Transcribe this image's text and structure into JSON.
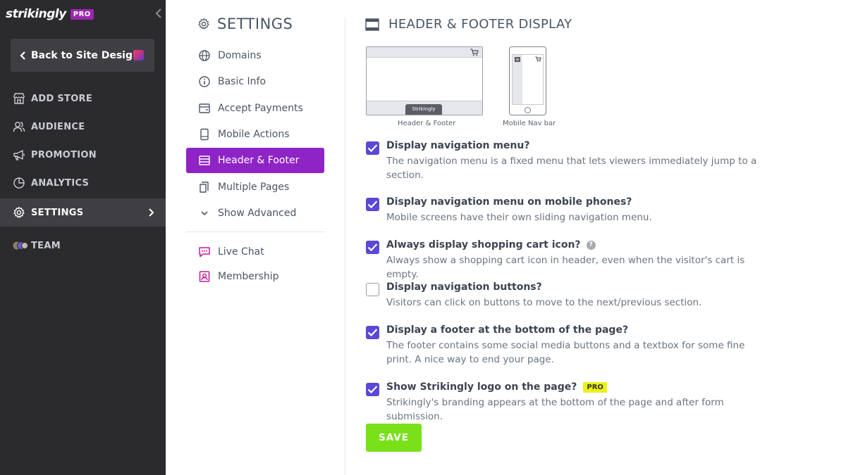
{
  "brand": {
    "logo_text": "strikingly",
    "plan_badge": "PRO"
  },
  "sidebar": {
    "back_label": "Back to Site Design",
    "items": [
      {
        "label": "ADD STORE",
        "icon": "store-icon"
      },
      {
        "label": "AUDIENCE",
        "icon": "users-icon"
      },
      {
        "label": "PROMOTION",
        "icon": "megaphone-icon"
      },
      {
        "label": "ANALYTICS",
        "icon": "pie-chart-icon"
      },
      {
        "label": "SETTINGS",
        "icon": "gear-icon",
        "active": true
      },
      {
        "label": "TEAM",
        "icon": "team-avatars-icon"
      }
    ]
  },
  "settings_nav": {
    "title": "SETTINGS",
    "items": [
      {
        "label": "Domains",
        "icon": "globe-icon"
      },
      {
        "label": "Basic Info",
        "icon": "info-icon"
      },
      {
        "label": "Accept Payments",
        "icon": "wallet-icon"
      },
      {
        "label": "Mobile Actions",
        "icon": "phone-icon"
      },
      {
        "label": "Header & Footer",
        "icon": "header-footer-icon",
        "active": true
      },
      {
        "label": "Multiple Pages",
        "icon": "pages-icon"
      },
      {
        "label": "Show Advanced",
        "icon": "chevron-down-icon"
      }
    ],
    "apps": [
      {
        "label": "Live Chat",
        "icon": "chat-icon"
      },
      {
        "label": "Membership",
        "icon": "membership-icon"
      }
    ]
  },
  "main": {
    "title": "HEADER & FOOTER DISPLAY",
    "previews": {
      "desktop_caption": "Header & Footer",
      "desktop_brand": "Strikingly",
      "mobile_caption": "Mobile Nav bar"
    },
    "options": [
      {
        "title": "Display navigation menu?",
        "desc": "The navigation menu is a fixed menu that lets viewers immediately jump to a section.",
        "checked": true
      },
      {
        "title": "Display navigation menu on mobile phones?",
        "desc": "Mobile screens have their own sliding navigation menu.",
        "checked": true
      },
      {
        "title": "Always display shopping cart icon?",
        "desc": "Always show a shopping cart icon in header, even when the visitor's cart is empty.",
        "checked": true,
        "help": "?"
      },
      {
        "title": "Display navigation buttons?",
        "desc": "Visitors can click on buttons to move to the next/previous section.",
        "checked": false
      },
      {
        "title": "Display a footer at the bottom of the page?",
        "desc": "The footer contains some social media buttons and a textbox for some fine print. A nice way to end your page.",
        "checked": true
      },
      {
        "title": "Show Strikingly logo on the page?",
        "desc": "Strikingly's branding appears at the bottom of the page and after form submission.",
        "checked": true,
        "badge": "PRO"
      }
    ],
    "save_label": "SAVE"
  },
  "colors": {
    "sidebar_bg": "#2b2b2e",
    "active_purple": "#8e24c6",
    "checkbox_blue": "#5a48d6",
    "save_green": "#79e01a",
    "pro_yellow": "#eaf217"
  }
}
